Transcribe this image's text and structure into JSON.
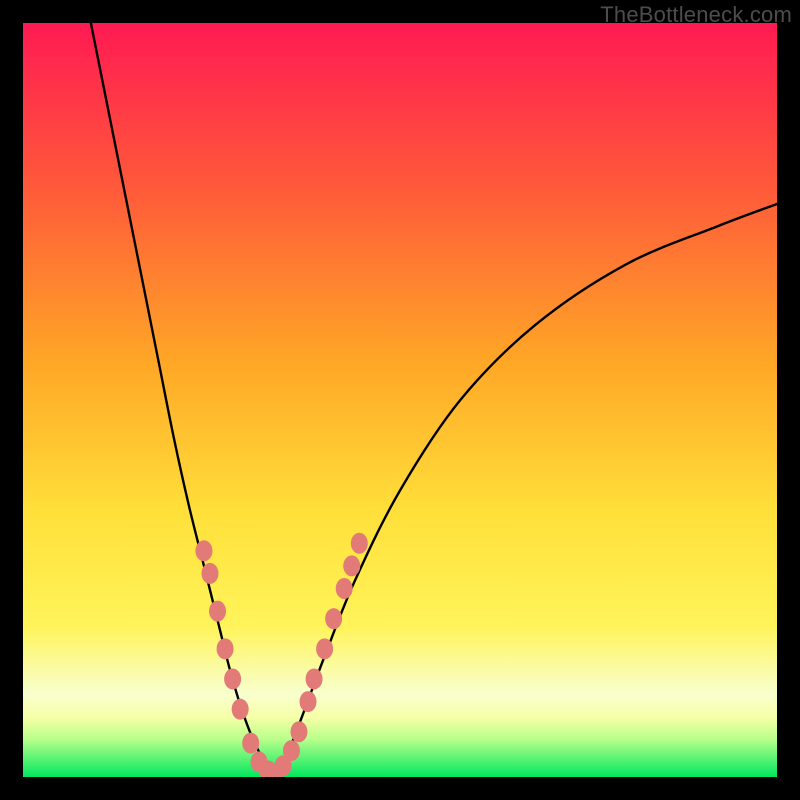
{
  "watermark": "TheBottleneck.com",
  "colors": {
    "bg_black": "#000000",
    "grad_top": "#ff1a52",
    "grad_mid1": "#ff7a2a",
    "grad_mid2": "#ffd21f",
    "grad_mid3": "#fff45a",
    "grad_mid4": "#f7ffa8",
    "grad_bottom_top": "#9bff7a",
    "grad_bottom": "#00e85e",
    "curve": "#000000",
    "marker_fill": "#e27a78",
    "marker_stroke": "#c96060"
  },
  "chart_data": {
    "type": "line",
    "title": "",
    "xlabel": "",
    "ylabel": "",
    "xlim": [
      0,
      100
    ],
    "ylim": [
      0,
      100
    ],
    "series": [
      {
        "name": "bottleneck-curve-left",
        "x": [
          9,
          12,
          15,
          18,
          20,
          22,
          24,
          26,
          27.5,
          29,
          30.5,
          32,
          33
        ],
        "y": [
          100,
          85,
          70,
          55,
          45,
          36,
          28,
          20,
          14,
          9,
          5,
          2,
          0
        ]
      },
      {
        "name": "bottleneck-curve-right",
        "x": [
          33,
          35,
          37,
          40,
          44,
          50,
          58,
          68,
          80,
          92,
          100
        ],
        "y": [
          0,
          3,
          8,
          16,
          26,
          38,
          50,
          60,
          68,
          73,
          76
        ]
      }
    ],
    "markers": {
      "name": "highlighted-points",
      "points": [
        {
          "x": 24.0,
          "y": 30
        },
        {
          "x": 24.8,
          "y": 27
        },
        {
          "x": 25.8,
          "y": 22
        },
        {
          "x": 26.8,
          "y": 17
        },
        {
          "x": 27.8,
          "y": 13
        },
        {
          "x": 28.8,
          "y": 9
        },
        {
          "x": 30.2,
          "y": 4.5
        },
        {
          "x": 31.3,
          "y": 2
        },
        {
          "x": 32.5,
          "y": 0.8
        },
        {
          "x": 33.5,
          "y": 0.5
        },
        {
          "x": 34.5,
          "y": 1.5
        },
        {
          "x": 35.6,
          "y": 3.5
        },
        {
          "x": 36.6,
          "y": 6
        },
        {
          "x": 37.8,
          "y": 10
        },
        {
          "x": 38.6,
          "y": 13
        },
        {
          "x": 40.0,
          "y": 17
        },
        {
          "x": 41.2,
          "y": 21
        },
        {
          "x": 42.6,
          "y": 25
        },
        {
          "x": 43.6,
          "y": 28
        },
        {
          "x": 44.6,
          "y": 31
        }
      ]
    },
    "gradient_bands_y": [
      {
        "y0": 100,
        "y1": 8,
        "from": "grad_top",
        "to": "grad_mid4"
      },
      {
        "y0": 8,
        "y1": 4,
        "from": "grad_mid4",
        "to": "grad_bottom_top"
      },
      {
        "y0": 4,
        "y1": 0,
        "from": "grad_bottom_top",
        "to": "grad_bottom"
      }
    ]
  }
}
